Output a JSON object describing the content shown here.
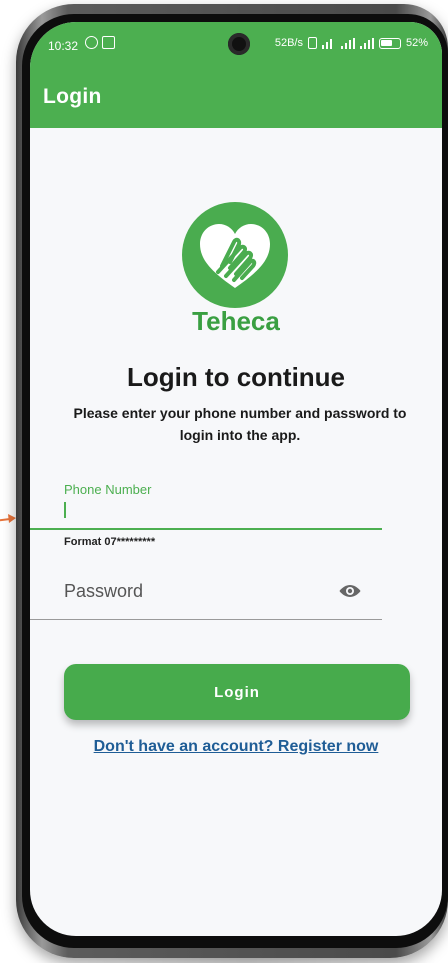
{
  "status_bar": {
    "time": "10:32",
    "network_speed": "52B/s",
    "battery": "52%"
  },
  "app_bar": {
    "title": "Login"
  },
  "brand": {
    "name": "Teheca",
    "color": "#4caf50"
  },
  "main": {
    "heading": "Login to continue",
    "subtext": "Please enter your phone number and password to login into the app.",
    "phone_field": {
      "label": "Phone Number",
      "value": ""
    },
    "format_hint": "Format 07*********",
    "password_field": {
      "placeholder": "Password",
      "icon": "eye-icon"
    },
    "login_button": "Login",
    "register_link": "Don't have an account? Register now"
  }
}
